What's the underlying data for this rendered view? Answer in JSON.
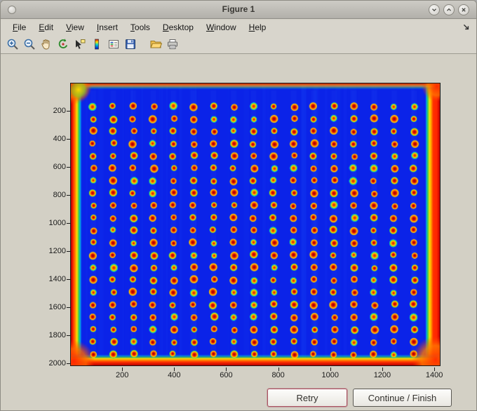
{
  "window": {
    "title": "Figure 1"
  },
  "window_controls": {
    "icons": [
      "minimize-icon",
      "maximize-icon",
      "close-icon"
    ]
  },
  "menu_bar": {
    "items": [
      {
        "label": "File"
      },
      {
        "label": "Edit"
      },
      {
        "label": "View"
      },
      {
        "label": "Insert"
      },
      {
        "label": "Tools"
      },
      {
        "label": "Desktop"
      },
      {
        "label": "Window"
      },
      {
        "label": "Help"
      }
    ]
  },
  "toolbar": {
    "icons": [
      "zoom-in-icon",
      "zoom-out-icon",
      "pan-icon",
      "rotate-3d-icon",
      "data-cursor-icon",
      "colorbar-icon",
      "legend-icon",
      "save-icon",
      "open-folder-icon",
      "print-icon"
    ]
  },
  "axes": {
    "x_ticks": [
      200,
      400,
      600,
      800,
      1000,
      1200,
      1400
    ],
    "y_ticks": [
      200,
      400,
      600,
      800,
      1000,
      1200,
      1400,
      1600,
      1800,
      2000
    ],
    "x_range": [
      0,
      1424
    ],
    "y_range": [
      0,
      2020
    ]
  },
  "plot": {
    "description": "microarray-plate image, jet colormap: blue field, grid of red/orange spots, hot red-orange borders",
    "rows": 21,
    "cols": 17,
    "grid": {
      "x0": 32,
      "dx": 28.7,
      "y0": 33,
      "dy": 17.75
    },
    "colors": {
      "base": "#0b23e8",
      "spot_core": "#9a0000",
      "spot_red": "#e01400",
      "spot_orange": "#ff7c00",
      "spot_yellow": "#ffe000",
      "spot_green": "#3cd24c",
      "spot_cyan": "#00c2e0",
      "edge_red": "#ff2400",
      "edge_dark_red": "#a80000"
    }
  },
  "buttons": {
    "retry": "Retry",
    "continue": "Continue / Finish"
  }
}
